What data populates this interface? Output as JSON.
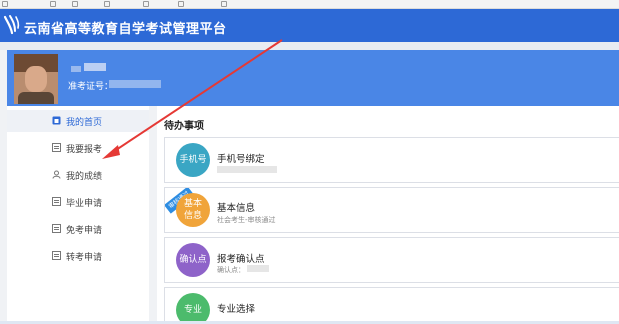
{
  "header": {
    "title": "云南省高等教育自学考试管理平台",
    "logo_icon": "swirl-logo-icon",
    "color": "#2d69d6"
  },
  "profile": {
    "exam_number_label": "准考证号："
  },
  "sidebar": {
    "items": [
      {
        "label": "我的首页",
        "icon": "home-icon",
        "active": true
      },
      {
        "label": "我要报考",
        "icon": "document-icon",
        "active": false
      },
      {
        "label": "我的成绩",
        "icon": "person-icon",
        "active": false
      },
      {
        "label": "毕业申请",
        "icon": "document-icon",
        "active": false
      },
      {
        "label": "免考申请",
        "icon": "document-icon",
        "active": false
      },
      {
        "label": "转考申请",
        "icon": "document-icon",
        "active": false
      }
    ]
  },
  "main": {
    "title": "待办事项",
    "tasks": [
      {
        "icon_text": "手机号",
        "title": "手机号绑定",
        "subtitle": "",
        "color": "#3aa6c4"
      },
      {
        "icon_text": "基本\n信息",
        "title": "基本信息",
        "subtitle": "社会考生-审核通过",
        "corner_tag": "审核通过",
        "color": "#f0a43a"
      },
      {
        "icon_text": "确认点",
        "title": "报考确认点",
        "subtitle": "确认点：",
        "color": "#8e63c9"
      },
      {
        "icon_text": "专业",
        "title": "专业选择",
        "subtitle": "",
        "color": "#4cbb6c"
      }
    ]
  },
  "annotation": {
    "color": "#e53935"
  }
}
